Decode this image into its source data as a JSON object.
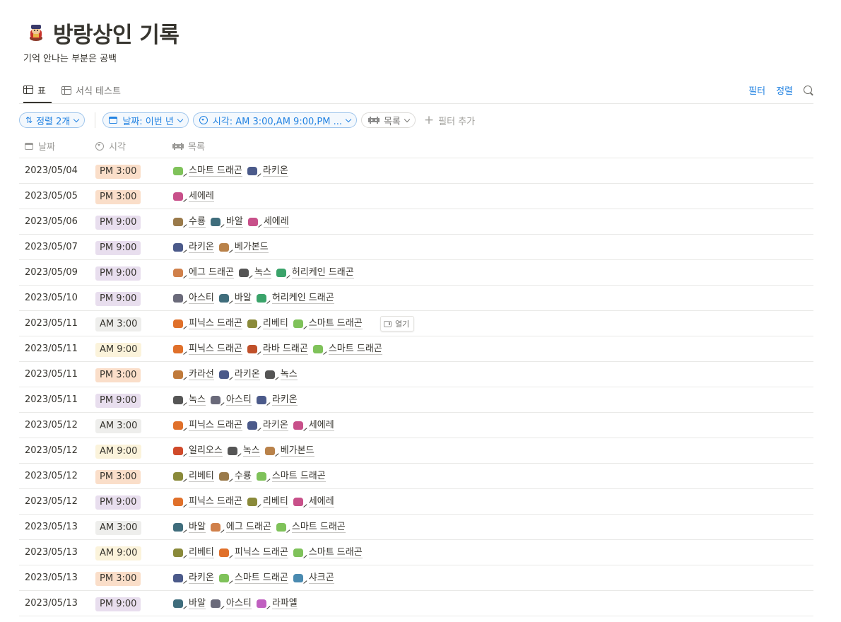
{
  "page": {
    "icon": "merchant-icon",
    "title": "방랑상인 기록",
    "subtitle": "기억 안나는 부분은 공백"
  },
  "views": {
    "tabs": [
      {
        "label": "표",
        "icon": "table-icon",
        "active": true
      },
      {
        "label": "서식 테스트",
        "icon": "table-icon",
        "active": false
      }
    ],
    "actions": {
      "filter": "필터",
      "sort": "정렬"
    }
  },
  "filter_bar": {
    "sort": "정렬 2개",
    "date_filter": "날짜: 이번 년",
    "time_filter": "시각: AM 3:00,AM 9:00,PM ...",
    "list_filter": "목록",
    "add_filter": "필터 추가"
  },
  "table": {
    "columns": {
      "date": "날짜",
      "time": "시각",
      "list": "목록"
    },
    "open_label": "열기",
    "colors": {
      "PM 3:00": "#fadec9",
      "PM 9:00": "#e8deee",
      "AM 3:00": "#eeeeec",
      "AM 9:00": "#fbf3db"
    },
    "rows": [
      {
        "date": "2023/05/04",
        "time": "PM 3:00",
        "items": [
          "스마트 드래곤",
          "라키온"
        ]
      },
      {
        "date": "2023/05/05",
        "time": "PM 3:00",
        "items": [
          "세에레"
        ]
      },
      {
        "date": "2023/05/06",
        "time": "PM 9:00",
        "items": [
          "수룡",
          "바알",
          "세에레"
        ]
      },
      {
        "date": "2023/05/07",
        "time": "PM 9:00",
        "items": [
          "라키온",
          "베가본드"
        ]
      },
      {
        "date": "2023/05/09",
        "time": "PM 9:00",
        "items": [
          "에그 드래곤",
          "녹스",
          "허리케인 드래곤"
        ]
      },
      {
        "date": "2023/05/10",
        "time": "PM 9:00",
        "items": [
          "아스티",
          "바알",
          "허리케인 드래곤"
        ]
      },
      {
        "date": "2023/05/11",
        "time": "AM 3:00",
        "items": [
          "피닉스 드래곤",
          "리베티",
          "스마트 드래곤"
        ]
      },
      {
        "date": "2023/05/11",
        "time": "AM 9:00",
        "items": [
          "피닉스 드래곤",
          "라바 드래곤",
          "스마트 드래곤"
        ]
      },
      {
        "date": "2023/05/11",
        "time": "PM 3:00",
        "items": [
          "카라선",
          "라키온",
          "녹스"
        ]
      },
      {
        "date": "2023/05/11",
        "time": "PM 9:00",
        "items": [
          "녹스",
          "아스티",
          "라키온"
        ]
      },
      {
        "date": "2023/05/12",
        "time": "AM 3:00",
        "items": [
          "피닉스 드래곤",
          "라키온",
          "세에레"
        ]
      },
      {
        "date": "2023/05/12",
        "time": "AM 9:00",
        "items": [
          "일리오스",
          "녹스",
          "베가본드"
        ]
      },
      {
        "date": "2023/05/12",
        "time": "PM 3:00",
        "items": [
          "리베티",
          "수룡",
          "스마트 드래곤"
        ]
      },
      {
        "date": "2023/05/12",
        "time": "PM 9:00",
        "items": [
          "피닉스 드래곤",
          "리베티",
          "세에레"
        ]
      },
      {
        "date": "2023/05/13",
        "time": "AM 3:00",
        "items": [
          "바알",
          "에그 드래곤",
          "스마트 드래곤"
        ]
      },
      {
        "date": "2023/05/13",
        "time": "AM 9:00",
        "items": [
          "리베티",
          "피닉스 드래곤",
          "스마트 드래곤"
        ]
      },
      {
        "date": "2023/05/13",
        "time": "PM 3:00",
        "items": [
          "라키온",
          "스마트 드래곤",
          "샤크곤"
        ]
      },
      {
        "date": "2023/05/13",
        "time": "PM 9:00",
        "items": [
          "바알",
          "아스티",
          "라파엘"
        ]
      }
    ]
  },
  "sprite_colors": {
    "스마트 드래곤": "#7fc25a",
    "라키온": "#4b5a8a",
    "세에레": "#c8508a",
    "수룡": "#9a7a4a",
    "바알": "#3f6d7c",
    "베가본드": "#b9824a",
    "에그 드래곤": "#d0804a",
    "녹스": "#555555",
    "허리케인 드래곤": "#3aa36a",
    "아스티": "#6a6a7a",
    "피닉스 드래곤": "#e0702a",
    "리베티": "#8a8a3a",
    "라바 드래곤": "#c0502a",
    "카라선": "#c07a3a",
    "일리오스": "#d04a2a",
    "샤크곤": "#4a8ab0",
    "라파엘": "#c060c0"
  }
}
